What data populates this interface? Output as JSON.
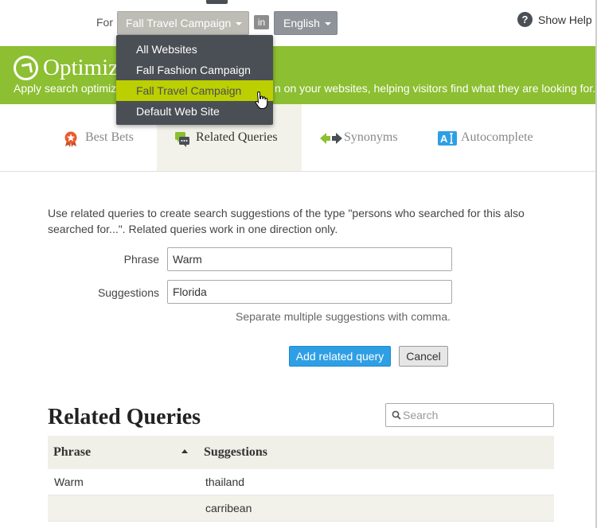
{
  "header": {
    "for_label": "For",
    "site_selected": "Fall Travel Campaign",
    "in_label": "in",
    "language": "English",
    "help_icon": "?",
    "help_label": "Show Help"
  },
  "site_dropdown": {
    "options": [
      "All Websites",
      "Fall Fashion Campaign",
      "Fall Travel Campaign",
      "Default Web Site"
    ],
    "active_index": 2
  },
  "banner": {
    "title": "Optimiz",
    "description_left": "Apply search optimiz",
    "description_right": "n on your websites, helping visitors find what they are looking for.",
    "color": "#8cbf31"
  },
  "tabs": [
    {
      "label": "Best Bets",
      "icon": "star-badge-icon"
    },
    {
      "label": "Related Queries",
      "icon": "chat-bubbles-icon"
    },
    {
      "label": "Synonyms",
      "icon": "two-way-arrow-icon"
    },
    {
      "label": "Autocomplete",
      "icon": "autocomplete-icon"
    }
  ],
  "tab_active": "Related Queries",
  "form": {
    "intro": "Use related queries to create search suggestions of the type \"persons who searched for this also searched for...\". Related queries work in one direction only.",
    "phrase_label": "Phrase",
    "phrase_value": "Warm",
    "suggestions_label": "Suggestions",
    "suggestions_value": "Florida",
    "hint": "Separate multiple suggestions with comma.",
    "add_button": "Add related query",
    "cancel_button": "Cancel"
  },
  "list": {
    "title": "Related Queries",
    "search_placeholder": "Search",
    "columns": [
      "Phrase",
      "Suggestions"
    ],
    "rows": [
      {
        "phrase": "Warm",
        "suggestion": "thailand"
      },
      {
        "phrase": "",
        "suggestion": "carribean"
      }
    ]
  },
  "colors": {
    "accent_blue": "#2f9fe5",
    "dropdown_bg": "#4a4f55",
    "dropdown_active": "#bccf00"
  }
}
